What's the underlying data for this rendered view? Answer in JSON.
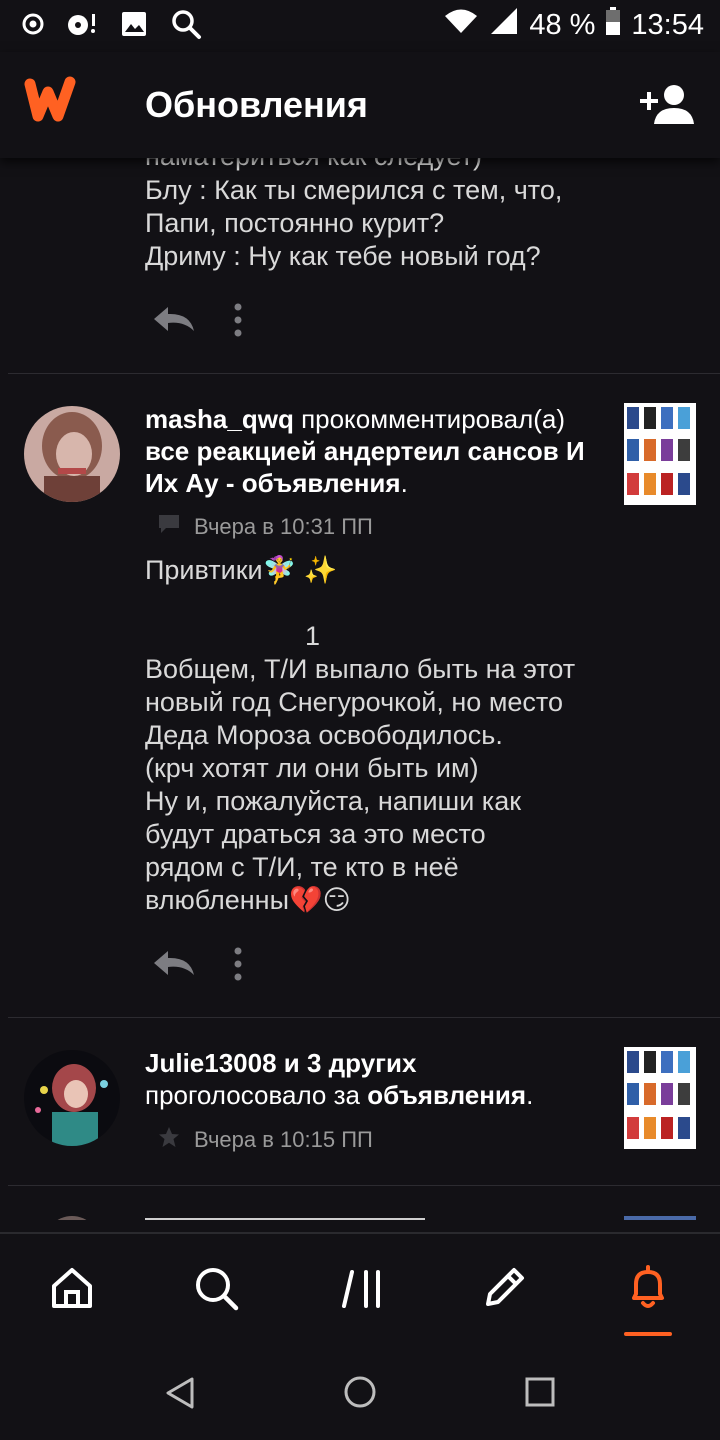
{
  "status_bar": {
    "battery": "48 %",
    "time": "13:54"
  },
  "header": {
    "title": "Обновления"
  },
  "partial_post": {
    "cut_line": "наматериться как следует)",
    "lines": [
      "Блу : Как ты смерился с тем, что,",
      "Папи, постоянно курит?",
      "Дриму : Ну как тебе новый год?"
    ]
  },
  "comment_item": {
    "username": "masha_qwq",
    "action": "прокомментировал(а)",
    "story": "все реакцией андертеил сансов И Их Ау - объявления",
    "period": ".",
    "time": "Вчера в 10:31 ПП",
    "body_greeting": "Привтики🧚‍♀️ ✨",
    "body_number": "1",
    "body_lines": [
      "Вобщем, Т/И выпало быть на этот",
      "новый год Снегурочкой, но место",
      "Деда Мороза освободилось.",
      "(крч хотят ли они быть им)",
      "Ну и, пожалуйста, напиши как",
      "будут драться за это место",
      "рядом с Т/И, те кто в неё",
      "влюбленны💔😏"
    ]
  },
  "vote_item": {
    "users": "Julie13008 и 3 других",
    "action": "проголосовало за",
    "story": "объявления",
    "period": ".",
    "time": "Вчера в 10:15 ПП"
  },
  "colors": {
    "accent": "#ff6122",
    "background": "#121115"
  }
}
